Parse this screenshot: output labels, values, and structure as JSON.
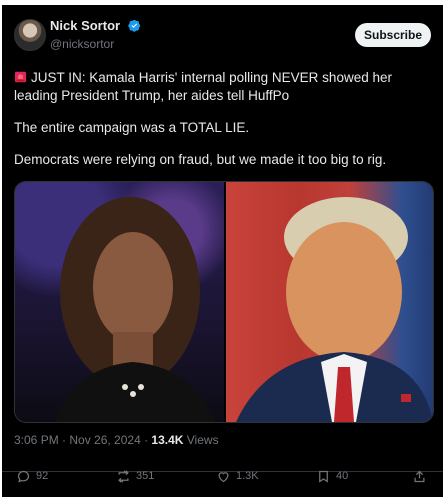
{
  "author": {
    "display_name": "Nick Sortor",
    "handle": "@nicksortor"
  },
  "header": {
    "subscribe_label": "Subscribe"
  },
  "tweet": {
    "line1": "JUST IN: Kamala Harris' internal polling NEVER showed her leading President Trump, her aides tell HuffPo",
    "line2": "The entire campaign was a TOTAL LIE.",
    "line3": "Democrats were relying on fraud, but we made it too big to rig."
  },
  "meta": {
    "timestamp": "3:06 PM · Nov 26, 2024 · ",
    "views_count": "13.4K",
    "views_label": " Views"
  },
  "actions": {
    "replies": "92",
    "reposts": "351",
    "likes": "1.3K",
    "bookmarks": "40"
  },
  "colors": {
    "background": "#000000",
    "text": "#e7e9ea",
    "muted": "#71767b",
    "verified": "#1d9bf0"
  }
}
